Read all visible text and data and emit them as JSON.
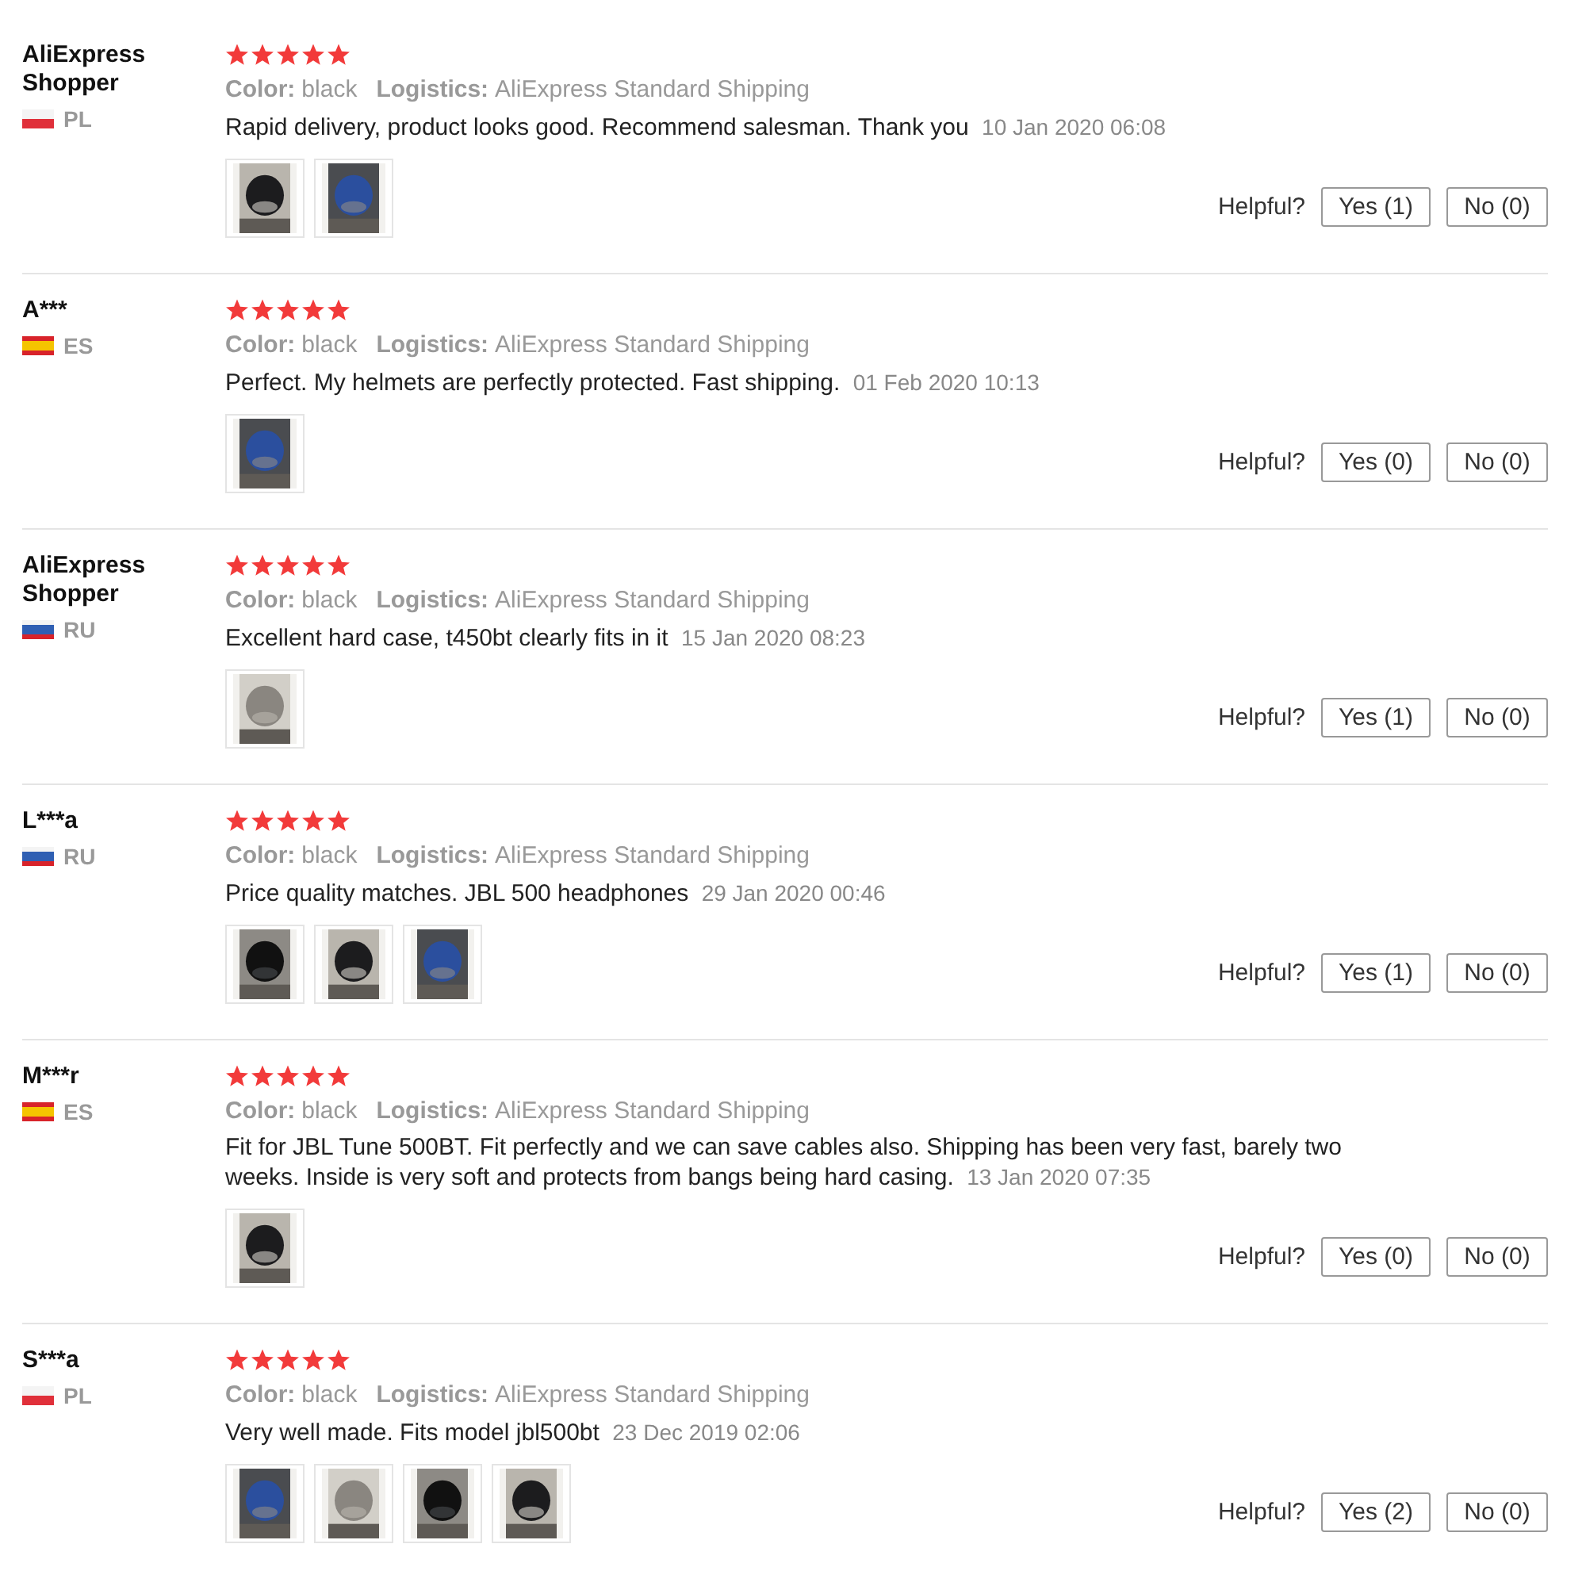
{
  "reviews": [
    {
      "name": "AliExpress Shopper",
      "flag": {
        "kind": "pl"
      },
      "country": "PL",
      "stars": 5,
      "color_label": "Color:",
      "color_value": "black",
      "logistics_label": "Logistics:",
      "logistics_value": "AliExpress Standard Shipping",
      "text": "Rapid delivery, product looks good. Recommend salesman. Thank you",
      "date": "10 Jan 2020 06:08",
      "photos": [
        {
          "kind": "picture"
        },
        {
          "kind": "picture"
        }
      ],
      "helpful": "Helpful?",
      "yes": "Yes (1)",
      "no": "No (0)"
    },
    {
      "name": "A***",
      "flag": {
        "kind": "es"
      },
      "country": "ES",
      "stars": 5,
      "color_label": "Color:",
      "color_value": "black",
      "logistics_label": "Logistics:",
      "logistics_value": "AliExpress Standard Shipping",
      "text": "Perfect. My helmets are perfectly protected. Fast shipping.",
      "date": "01 Feb 2020 10:13",
      "photos": [
        {
          "kind": "picture"
        }
      ],
      "helpful": "Helpful?",
      "yes": "Yes (0)",
      "no": "No (0)"
    },
    {
      "name": "AliExpress Shopper",
      "flag": {
        "kind": "ru"
      },
      "country": "RU",
      "stars": 5,
      "color_label": "Color:",
      "color_value": "black",
      "logistics_label": "Logistics:",
      "logistics_value": "AliExpress Standard Shipping",
      "text": "Excellent hard case, t450bt clearly fits in it",
      "date": "15 Jan 2020 08:23",
      "photos": [
        {
          "kind": "picture"
        }
      ],
      "helpful": "Helpful?",
      "yes": "Yes (1)",
      "no": "No (0)"
    },
    {
      "name": "L***a",
      "flag": {
        "kind": "ru"
      },
      "country": "RU",
      "stars": 5,
      "color_label": "Color:",
      "color_value": "black",
      "logistics_label": "Logistics:",
      "logistics_value": "AliExpress Standard Shipping",
      "text": "Price quality matches. JBL 500 headphones",
      "date": "29 Jan 2020 00:46",
      "photos": [
        {
          "kind": "picture"
        },
        {
          "kind": "picture"
        },
        {
          "kind": "picture"
        }
      ],
      "helpful": "Helpful?",
      "yes": "Yes (1)",
      "no": "No (0)"
    },
    {
      "name": "M***r",
      "flag": {
        "kind": "es"
      },
      "country": "ES",
      "stars": 5,
      "color_label": "Color:",
      "color_value": "black",
      "logistics_label": "Logistics:",
      "logistics_value": "AliExpress Standard Shipping",
      "text": "Fit for JBL Tune 500BT. Fit perfectly and we can save cables also. Shipping has been very fast, barely two weeks. Inside is very soft and protects from bangs being hard casing.",
      "date": "13 Jan 2020 07:35",
      "photos": [
        {
          "kind": "picture"
        }
      ],
      "helpful": "Helpful?",
      "yes": "Yes (0)",
      "no": "No (0)"
    },
    {
      "name": "S***a",
      "flag": {
        "kind": "pl"
      },
      "country": "PL",
      "stars": 5,
      "color_label": "Color:",
      "color_value": "black",
      "logistics_label": "Logistics:",
      "logistics_value": "AliExpress Standard Shipping",
      "text": "Very well made. Fits model jbl500bt",
      "date": "23 Dec 2019 02:06",
      "photos": [
        {
          "kind": "picture"
        },
        {
          "kind": "picture"
        },
        {
          "kind": "picture"
        },
        {
          "kind": "picture"
        }
      ],
      "helpful": "Helpful?",
      "yes": "Yes (2)",
      "no": "No (0)"
    }
  ]
}
